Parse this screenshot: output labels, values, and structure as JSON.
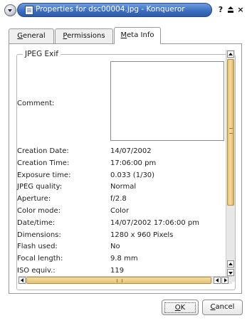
{
  "window": {
    "title": "Properties for dsc00004.jpg - Konqueror",
    "buttons": {
      "help": "?",
      "close": "×"
    }
  },
  "tabs": [
    {
      "access_key": "G",
      "rest": "eneral"
    },
    {
      "access_key": "P",
      "rest": "ermissions"
    },
    {
      "access_key": "M",
      "rest": "eta Info"
    }
  ],
  "group": {
    "title": "JPEG Exif",
    "comment_label": "Comment:",
    "comment_value": ""
  },
  "rows": [
    {
      "key": "Creation Date:",
      "value": "14/07/2002"
    },
    {
      "key": "Creation Time:",
      "value": "17:06:00 pm"
    },
    {
      "key": "Exposure time:",
      "value": " 0.033 (1/30)"
    },
    {
      "key": "JPEG quality:",
      "value": "Normal"
    },
    {
      "key": "Aperture:",
      "value": "f/2.8"
    },
    {
      "key": "Color mode:",
      "value": "Color"
    },
    {
      "key": "Date/time:",
      "value": "14/07/2002 17:06:00 pm"
    },
    {
      "key": "Dimensions:",
      "value": "1280 x 960  Pixels"
    },
    {
      "key": "Flash used:",
      "value": "No"
    },
    {
      "key": "Focal length:",
      "value": " 9.8  mm"
    },
    {
      "key": "ISO equiv.:",
      "value": "119"
    }
  ],
  "buttons": {
    "ok": {
      "access_key": "O",
      "rest": "K"
    },
    "cancel": {
      "access_key": "C",
      "rest": "ancel"
    }
  },
  "colors": {
    "title_gradient": "#3d6fc0",
    "scroll_thumb": "#f6dc9b"
  }
}
